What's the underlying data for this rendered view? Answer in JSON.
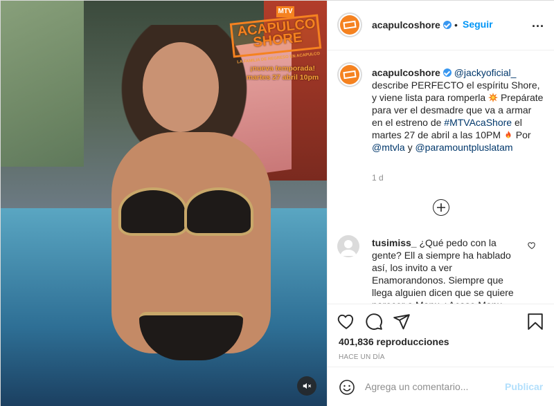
{
  "media": {
    "logo_badge": "MTV",
    "logo_title": "ACAPULCO SHORE",
    "logo_tagline": "LA FAMILIA DE REGRESO EN ACAPULCO",
    "promo_line1": "¡nueva temporada!",
    "promo_line2": "martes 27 abril 10pm",
    "mute_icon": "speaker-muted-icon"
  },
  "header": {
    "username": "acapulcoshore",
    "verified_icon": "verified-badge-icon",
    "separator": "•",
    "follow_label": "Seguir",
    "more_label": "..."
  },
  "caption": {
    "username": "acapulcoshore",
    "mention1": "@jackyoficial_",
    "text1": "describe PERFECTO el espíritu Shore, y viene lista para romperla",
    "emoji1": "collision-emoji",
    "text2": "Prepárate para ver el desmadre que va a armar en el estreno de",
    "hashtag": "#MTVAcaShore",
    "text3": "el martes 27 de abril a las 10PM",
    "emoji2": "fire-emoji",
    "text4": "Por",
    "mention2": "@mtvla",
    "text5": "y",
    "mention3": "@paramountpluslatam",
    "time": "1 d"
  },
  "comment": {
    "username": "tusimiss_",
    "text": "¿Qué pedo con la gente? Ell a siempre ha hablado así, los invito a ver Enamorandonos. Siempre que llega alguien dicen que se quiere parecer a Manu ¿Acaso Manu"
  },
  "actions": {
    "like_icon": "heart-icon",
    "comment_icon": "comment-bubble-icon",
    "share_icon": "paper-plane-icon",
    "save_icon": "bookmark-icon",
    "views": "401,836 reproducciones",
    "time": "HACE UN DÍA"
  },
  "composer": {
    "placeholder": "Agrega un comentario...",
    "publish_label": "Publicar",
    "emoji_icon": "smiley-icon"
  },
  "colors": {
    "accent": "#0095f6",
    "brand": "#f58220",
    "link": "#00376b",
    "muted": "#8e8e8e"
  }
}
